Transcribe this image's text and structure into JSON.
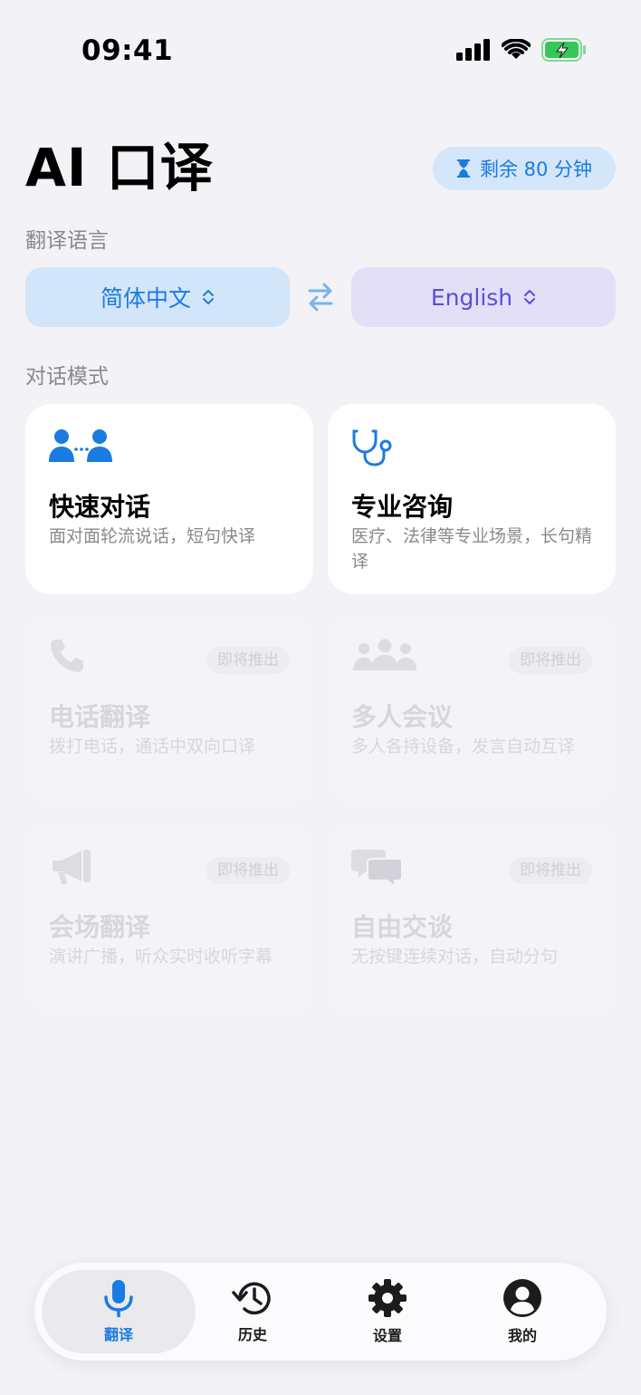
{
  "status": {
    "time": "09:41"
  },
  "header": {
    "title": "AI 口译",
    "quota": "剩余 80 分钟"
  },
  "language": {
    "section_label": "翻译语言",
    "source": "简体中文",
    "target": "English"
  },
  "modes": {
    "section_label": "对话模式",
    "coming_soon": "即将推出",
    "items": [
      {
        "name": "快速对话",
        "desc": "面对面轮流说话，短句快译",
        "icon": "two-people-icon"
      },
      {
        "name": "专业咨询",
        "desc": "医疗、法律等专业场景，长句精译",
        "icon": "stethoscope-icon"
      },
      {
        "name": "电话翻译",
        "desc": "拨打电话，通话中双向口译",
        "icon": "phone-icon"
      },
      {
        "name": "多人会议",
        "desc": "多人各持设备，发言自动互译",
        "icon": "group-icon"
      },
      {
        "name": "会场翻译",
        "desc": "演讲广播，听众实时收听字幕",
        "icon": "megaphone-icon"
      },
      {
        "name": "自由交谈",
        "desc": "无按键连续对话，自动分句",
        "icon": "chat-bubbles-icon"
      }
    ]
  },
  "tabbar": {
    "items": [
      {
        "label": "翻译",
        "icon": "mic-icon",
        "active": true
      },
      {
        "label": "历史",
        "icon": "history-icon",
        "active": false
      },
      {
        "label": "设置",
        "icon": "gear-icon",
        "active": false
      },
      {
        "label": "我的",
        "icon": "person-icon",
        "active": false
      }
    ]
  },
  "colors": {
    "accent": "#1a7be0",
    "target_lang": "#5a4fd6",
    "background": "#f2f2f7"
  }
}
